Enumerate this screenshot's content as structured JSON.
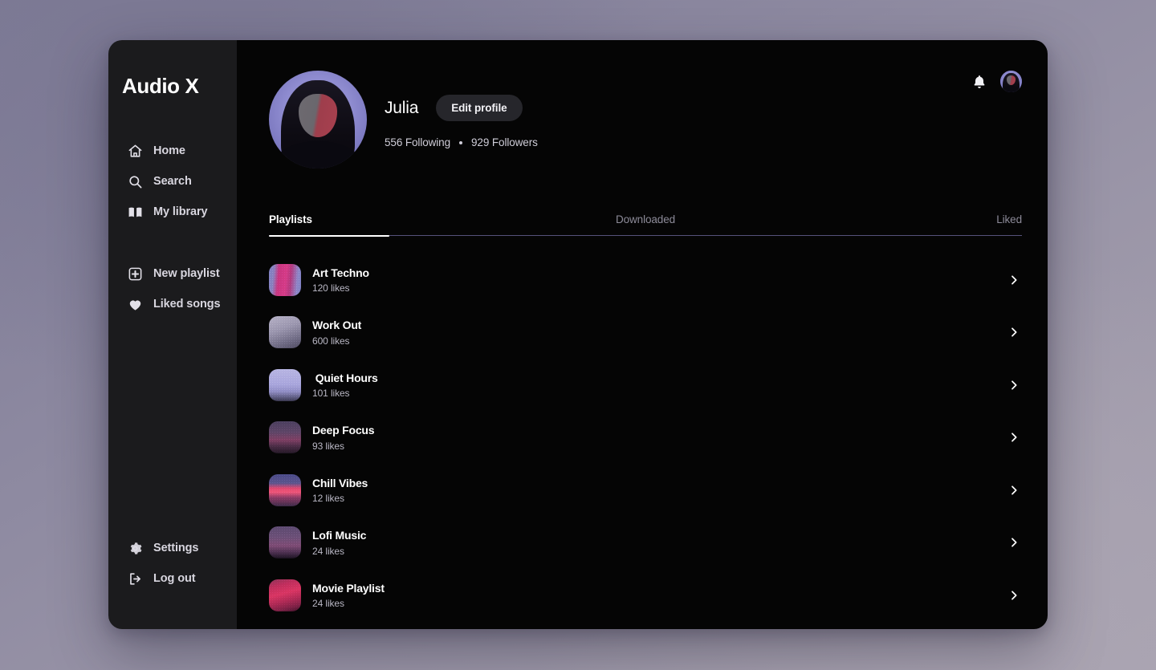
{
  "brand": {
    "name": "Audio X"
  },
  "sidebar": {
    "primary_items": [
      {
        "label": "Home",
        "icon": "home-icon"
      },
      {
        "label": "Search",
        "icon": "search-icon"
      },
      {
        "label": "My library",
        "icon": "book-icon"
      }
    ],
    "secondary_items": [
      {
        "label": "New playlist",
        "icon": "plus-square-icon"
      },
      {
        "label": "Liked songs",
        "icon": "heart-icon"
      }
    ],
    "bottom_items": [
      {
        "label": "Settings",
        "icon": "gear-icon"
      },
      {
        "label": "Log out",
        "icon": "logout-icon"
      }
    ]
  },
  "top_actions": {
    "notifications_icon": "bell-icon",
    "avatar_icon": "user-avatar"
  },
  "profile": {
    "name": "Julia",
    "edit_button": "Edit profile",
    "following": "556 Following",
    "followers": "929 Followers"
  },
  "tabs": [
    {
      "label": "Playlists",
      "active": true
    },
    {
      "label": "Downloaded",
      "active": false
    },
    {
      "label": "Liked",
      "active": false
    }
  ],
  "playlists": [
    {
      "title": "Art Techno",
      "likes": "120 likes"
    },
    {
      "title": "Work Out",
      "likes": "600 likes"
    },
    {
      "title": " Quiet Hours",
      "likes": "101 likes"
    },
    {
      "title": "Deep Focus",
      "likes": "93 likes"
    },
    {
      "title": "Chill Vibes",
      "likes": "12 likes"
    },
    {
      "title": "Lofi Music",
      "likes": "24 likes"
    },
    {
      "title": "Movie Playlist",
      "likes": "24 likes"
    }
  ],
  "colors": {
    "desktop_background": "#8e8aa1",
    "sidebar_background": "#1b1b1d",
    "main_background": "#050505",
    "accent_white": "#ffffff",
    "muted_text": "#8d8b99",
    "button_background": "#26262b"
  }
}
